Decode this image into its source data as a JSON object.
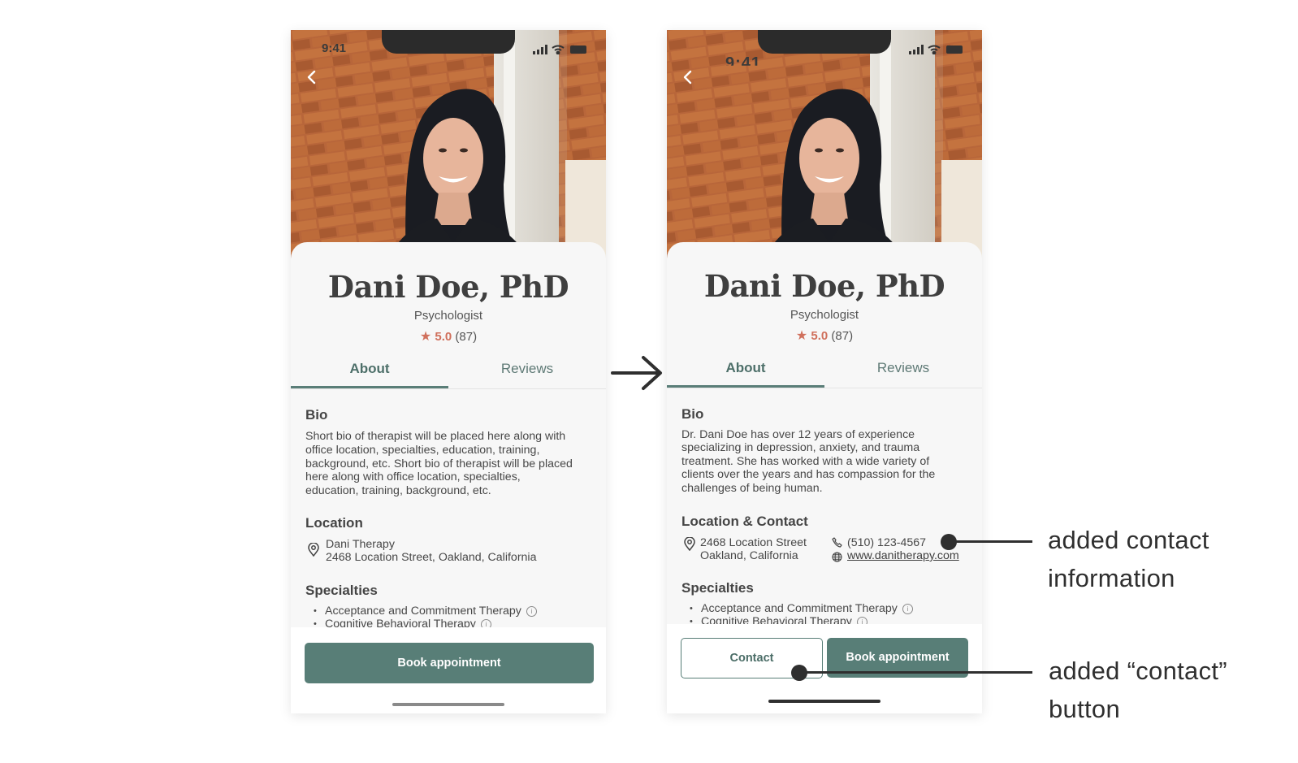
{
  "status": {
    "time": "9:41"
  },
  "profile": {
    "name": "Dani Doe, PhD",
    "profession": "Psychologist",
    "rating_star": "★",
    "rating_score": "5.0",
    "rating_count": "(87)"
  },
  "tabs": {
    "about": "About",
    "reviews": "Reviews"
  },
  "before": {
    "bio_title": "Bio",
    "bio_lines": [
      "Short bio of therapist will be placed here along with",
      "office location, specialties, education, training,",
      "background, etc. Short bio of therapist will be placed",
      "here along with office location, specialties,",
      "education, training, background, etc."
    ],
    "location_title": "Location",
    "location_name": "Dani Therapy",
    "location_address": "2468 Location Street, Oakland, California",
    "specialties_title": "Specialties",
    "specialties": [
      "Acceptance and Commitment Therapy",
      "Cognitive Behavioral Therapy"
    ],
    "book_label": "Book appointment"
  },
  "after": {
    "bio_title": "Bio",
    "bio_lines": [
      "Dr. Dani Doe has over 12 years of experience",
      "specializing in depression, anxiety, and trauma",
      "treatment. She has worked with a wide variety of",
      "clients over the years and has compassion for the",
      "challenges of being human."
    ],
    "location_title": "Location & Contact",
    "address_line1": "2468 Location Street",
    "address_line2": "Oakland, California",
    "phone": "(510) 123-4567",
    "website": "www.danitherapy.com",
    "specialties_title": "Specialties",
    "specialties": [
      "Acceptance and Commitment Therapy",
      "Cognitive Behavioral Therapy"
    ],
    "contact_label": "Contact",
    "book_label": "Book appointment"
  },
  "annotations": {
    "contact_info": [
      "added contact",
      "information"
    ],
    "contact_button": [
      "added “contact”",
      "button"
    ]
  },
  "colors": {
    "accent": "#587e77",
    "star": "#d0705c",
    "annotation": "#2f2f2f"
  },
  "icons": [
    "back-chevron-icon",
    "signal-icon",
    "wifi-icon",
    "battery-icon",
    "star-icon",
    "map-pin-icon",
    "phone-icon",
    "globe-icon",
    "info-icon",
    "arrow-right-icon"
  ]
}
